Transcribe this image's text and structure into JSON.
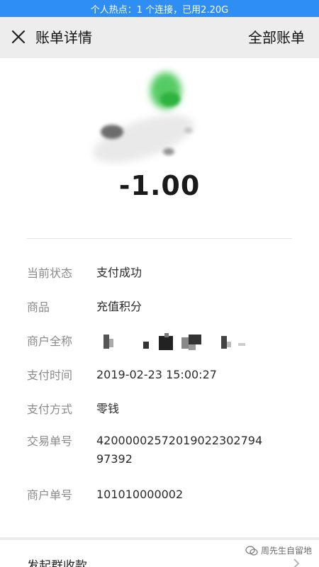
{
  "status_bar": {
    "text": "个人热点：1 个连接，已用2.20G"
  },
  "nav": {
    "title": "账单详情",
    "right_label": "全部账单"
  },
  "transaction": {
    "amount": "-1.00"
  },
  "details": [
    {
      "label": "当前状态",
      "value": "支付成功"
    },
    {
      "label": "商品",
      "value": "充值积分"
    },
    {
      "label": "商户全称",
      "value": ""
    },
    {
      "label": "支付时间",
      "value": "2019-02-23 15:00:27"
    },
    {
      "label": "支付方式",
      "value": "零钱"
    },
    {
      "label": "交易单号",
      "value": "4200000257201902230279497392"
    },
    {
      "label": "商户单号",
      "value": "101010000002"
    }
  ],
  "bottom": {
    "action_label": "发起群收款",
    "watermark": "周先生自留地"
  },
  "colors": {
    "status_bar": "#2f8ef4",
    "background": "#ededed",
    "card": "#ffffff",
    "label_gray": "#8a8a8a",
    "logo_green": "#39c34a"
  },
  "icons": {
    "close": "close-icon",
    "merchant_logo": "merchant-logo-blurred",
    "chevron": "chevron-right-icon",
    "watermark": "wechat-icon"
  }
}
